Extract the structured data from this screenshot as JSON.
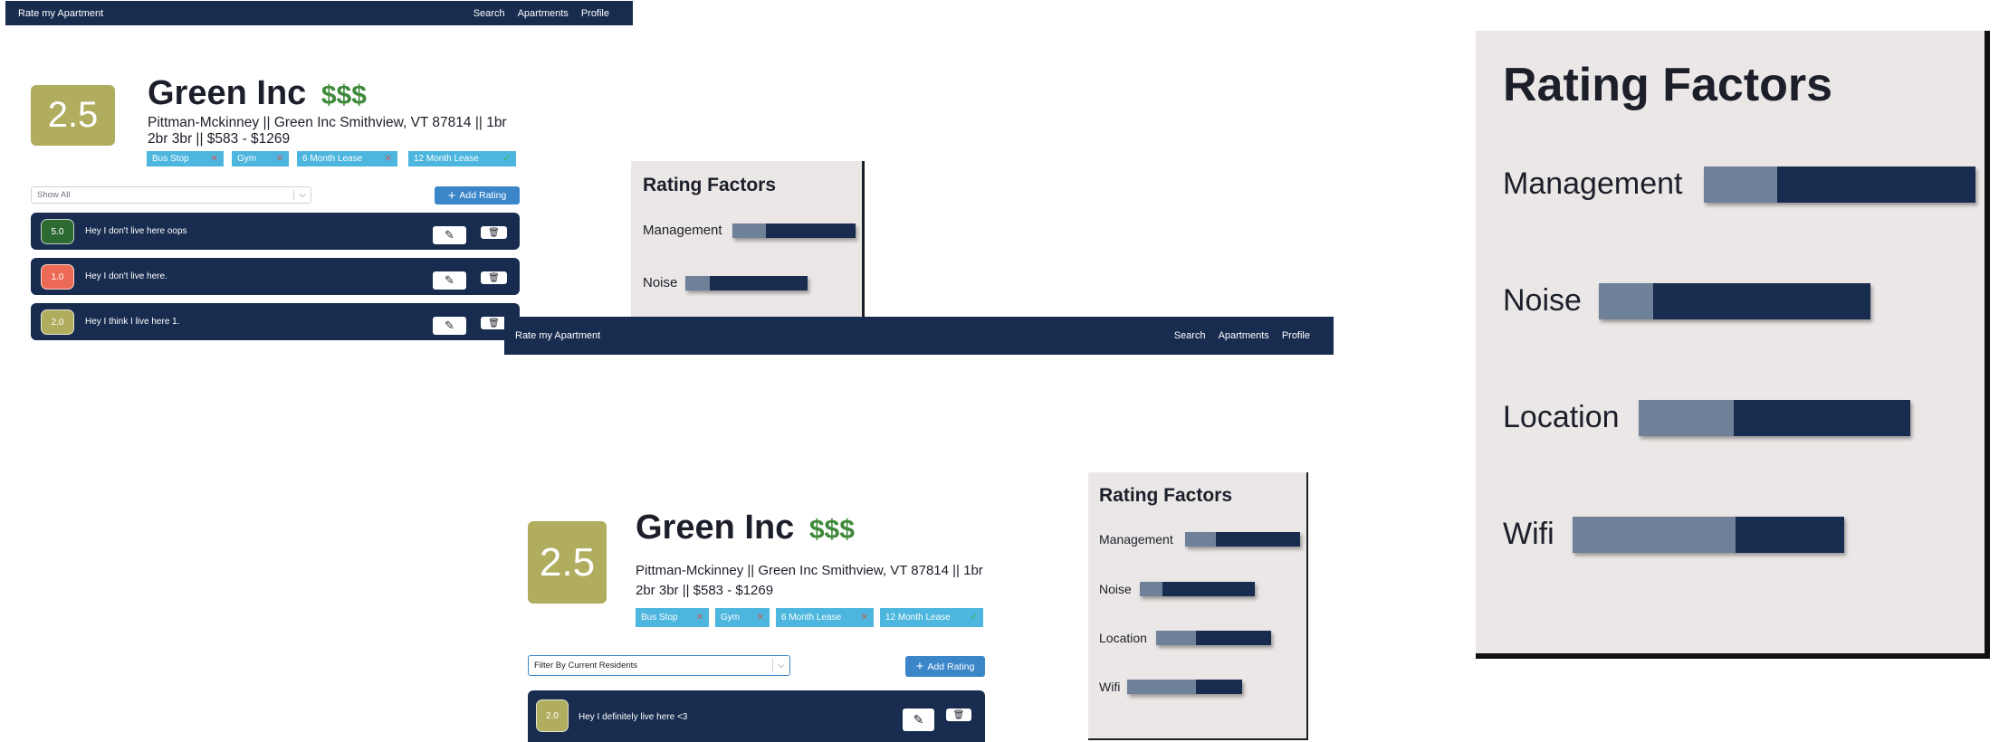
{
  "nav": {
    "brand": "Rate my Apartment",
    "links": [
      "Search",
      "Apartments",
      "Profile"
    ]
  },
  "apartment": {
    "score": "2.5",
    "name": "Green Inc",
    "price": "$$$",
    "address_line1": "Pittman-Mckinney || Green Inc Smithview, VT 87814 || 1br",
    "address_line2": "2br 3br || $583 - $1269",
    "tags": [
      {
        "label": "Bus Stop",
        "status": "✕"
      },
      {
        "label": "Gym",
        "status": "✕"
      },
      {
        "label": "6 Month Lease",
        "status": "✕"
      },
      {
        "label": "12 Month Lease",
        "status": "✓"
      }
    ]
  },
  "screen1": {
    "filter_value": "Show All",
    "add_rating_label": "Add Rating",
    "reviews": [
      {
        "score": "5.0",
        "text": "Hey I don't live here oops",
        "color": "#2d6a32"
      },
      {
        "score": "1.0",
        "text": "Hey I don't live here.",
        "color": "#ec6a55"
      },
      {
        "score": "2.0",
        "text": "Hey I think I live here 1.",
        "color": "#b0ad5f"
      }
    ]
  },
  "screen2": {
    "filter_value": "Filter By Current Residents",
    "add_rating_label": "Add Rating",
    "reviews": [
      {
        "score": "2.0",
        "text": "Hey I definitely live here <3",
        "color": "#b0ad5f"
      }
    ]
  },
  "rating_factors": {
    "title": "Rating Factors",
    "factors": [
      {
        "label": "Management",
        "score_fraction": 0.27
      },
      {
        "label": "Noise",
        "score_fraction": 0.2
      },
      {
        "label": "Location",
        "score_fraction": 0.35
      },
      {
        "label": "Wifi",
        "score_fraction": 0.6
      }
    ]
  },
  "colors": {
    "navy": "#172c4f",
    "olive": "#b0ad5f",
    "green": "#3f8a3b",
    "tag_blue": "#4db6de",
    "button_blue": "#3a86c8",
    "panel": "#ebe7e6"
  },
  "icons": [
    "plus-icon",
    "pencil-icon",
    "trash-icon",
    "close-icon",
    "check-icon",
    "chevron-down-icon"
  ]
}
